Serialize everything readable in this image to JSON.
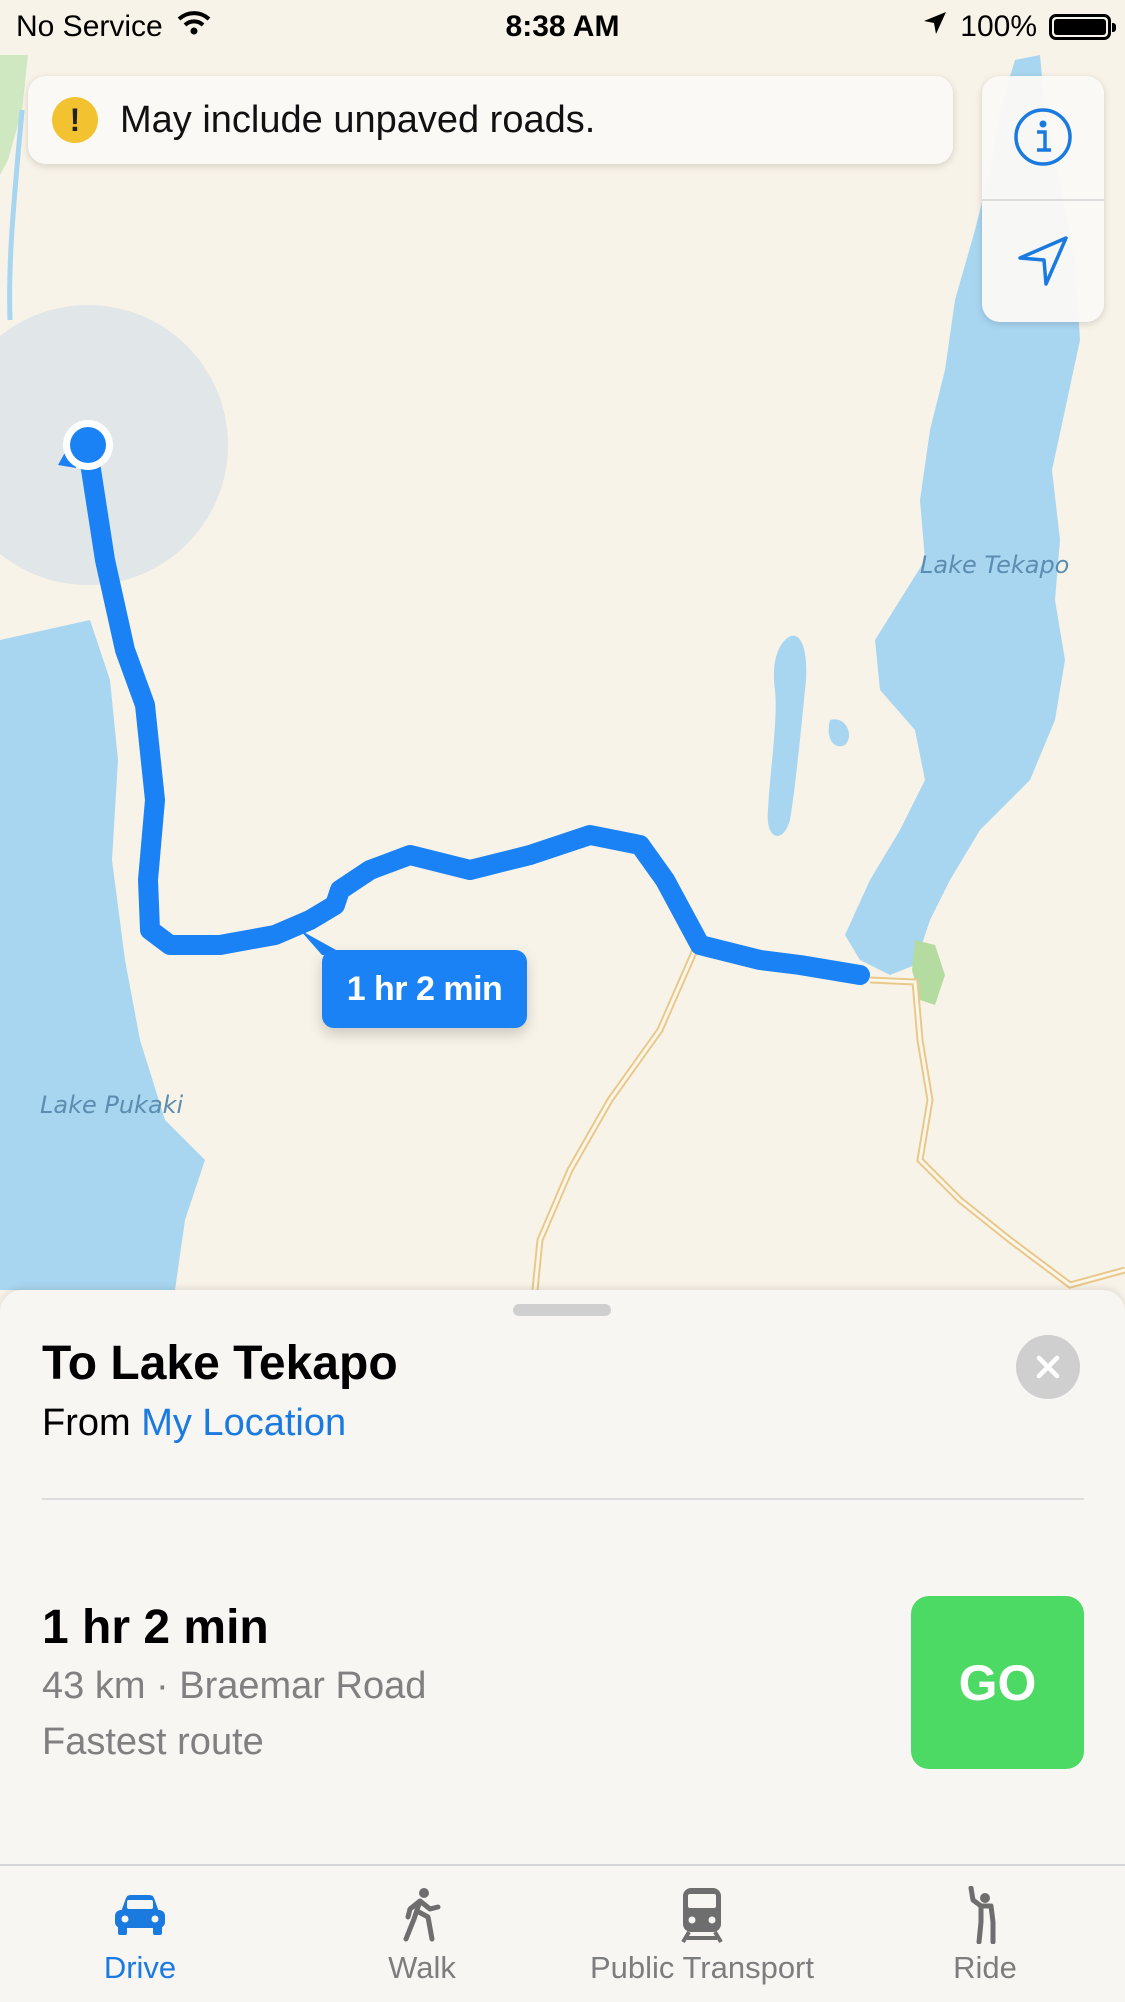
{
  "status_bar": {
    "carrier": "No Service",
    "time": "8:38 AM",
    "battery": "100%",
    "battery_level": 1.0
  },
  "map": {
    "warning": "May include unpaved roads.",
    "labels": {
      "lake_tekapo": "Lake Tekapo",
      "lake_pukaki": "Lake Pukaki"
    },
    "eta_bubble": "1 hr 2 min",
    "controls": {
      "info_icon": "info-icon",
      "location_icon": "location-arrow-icon"
    },
    "route_color": "#1a82f5",
    "water_color": "#a8d6f0",
    "land_color": "#f8f3e8"
  },
  "route_card": {
    "title": "To Lake Tekapo",
    "from_prefix": "From",
    "from_link": "My Location",
    "route_time": "1 hr 2 min",
    "route_detail": "43 km · Braemar Road",
    "route_note": "Fastest route",
    "go_label": "GO",
    "go_color": "#4cd964"
  },
  "tabs": [
    {
      "label": "Drive",
      "icon": "car-icon",
      "active": true
    },
    {
      "label": "Walk",
      "icon": "walk-icon",
      "active": false
    },
    {
      "label": "Public Transport",
      "icon": "train-icon",
      "active": false
    },
    {
      "label": "Ride",
      "icon": "ride-icon",
      "active": false
    }
  ]
}
